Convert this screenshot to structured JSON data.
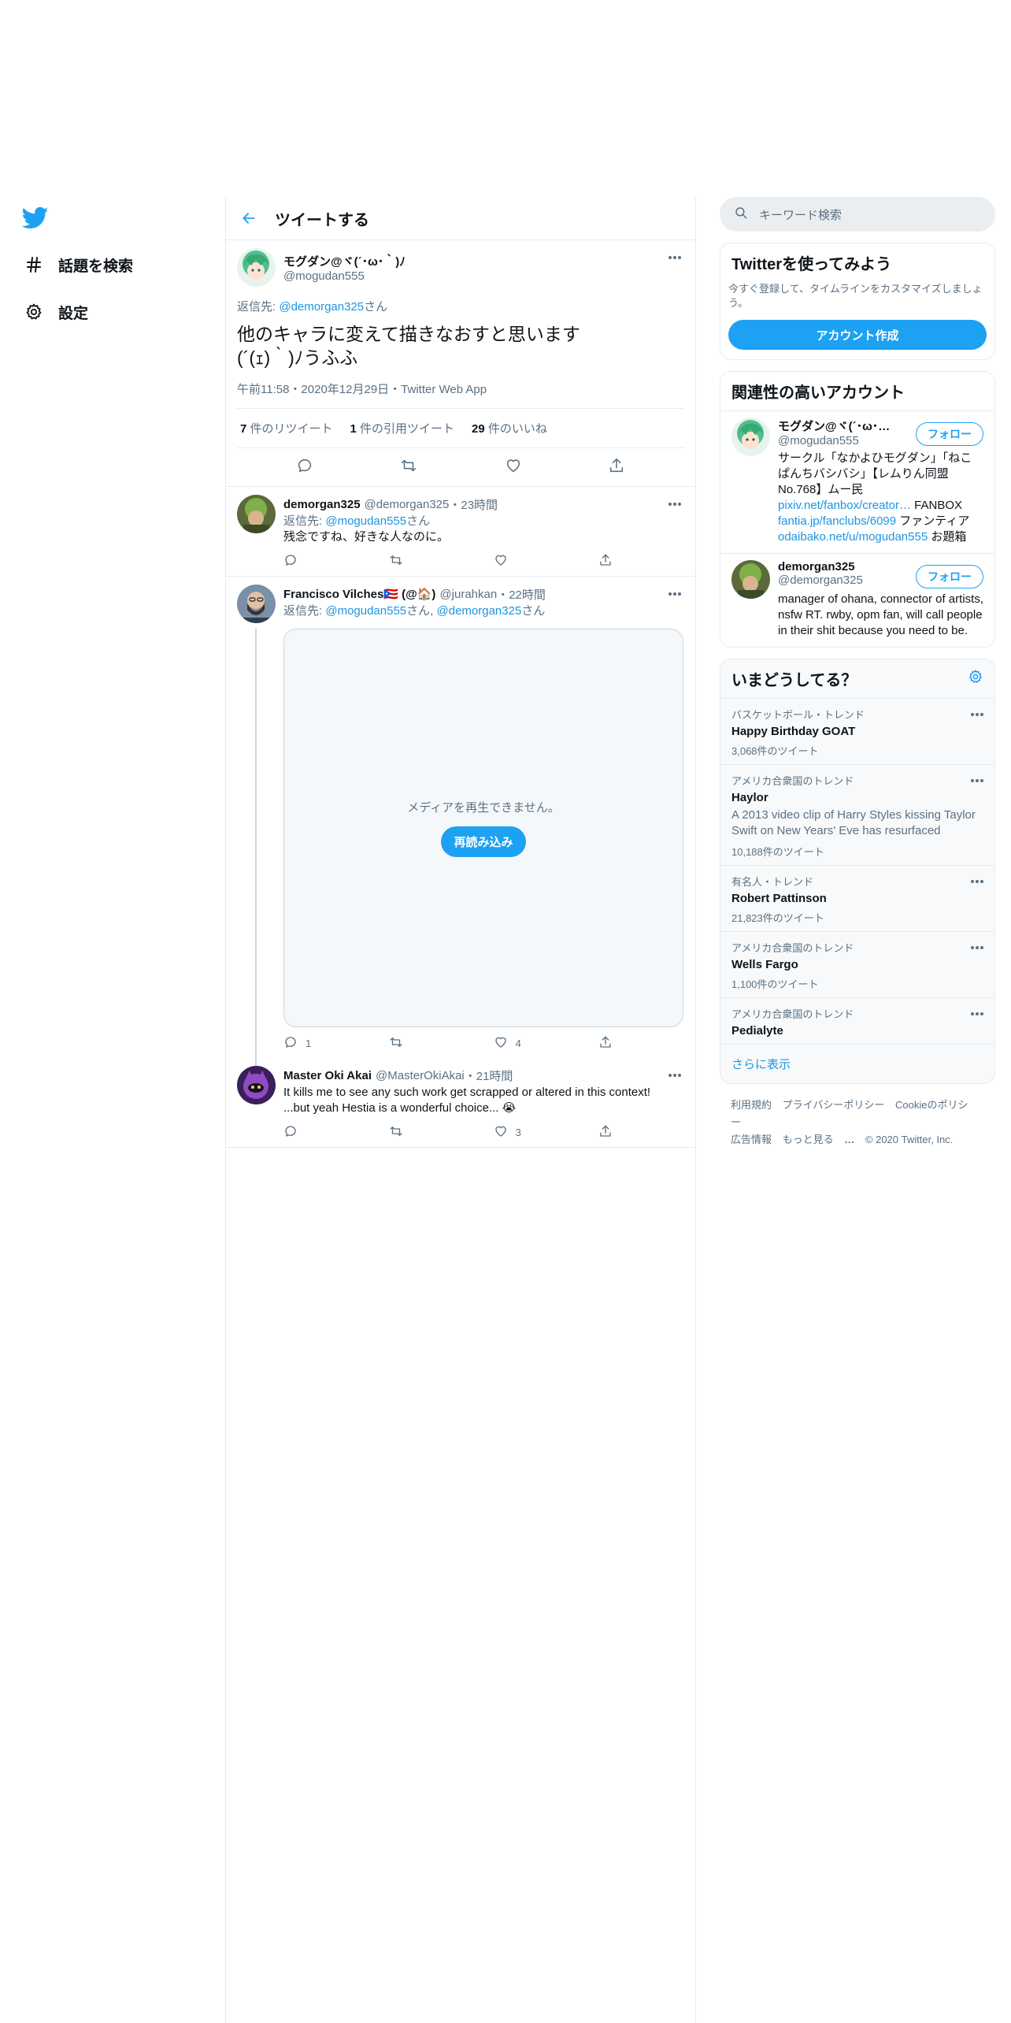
{
  "nav": {
    "logo_icon": "twitter-bird-icon",
    "items": [
      {
        "icon": "hashtag-icon",
        "label": "話題を検索"
      },
      {
        "icon": "gear-icon",
        "label": "設定"
      }
    ]
  },
  "header": {
    "title": "ツイートする"
  },
  "focal": {
    "name": "モグダン@ヾ(´･ω･｀)ﾉ",
    "handle": "@mogudan555",
    "reply_prefix": "返信先: ",
    "reply_to": "@demorgan325",
    "reply_suffix": "さん",
    "text_line1": "他のキャラに変えて描きなおすと思います",
    "text_line2": "(´(ｪ)｀)ﾉうふふ",
    "meta": "午前11:58・2020年12月29日・Twitter Web App",
    "retweets_count": "7",
    "retweets_label": " 件のリツイート",
    "quotes_count": "1",
    "quotes_label": " 件の引用ツイート",
    "likes_count": "29",
    "likes_label": " 件のいいね"
  },
  "replies": [
    {
      "name": "demorgan325",
      "handle": "@demorgan325",
      "time": "・23時間",
      "reply_prefix": "返信先: ",
      "reply_to": "@mogudan555",
      "reply_suffix": "さん",
      "text": "残念ですね、好きな人なのに。"
    },
    {
      "name": "Francisco Vilches🇵🇷 (@🏠)",
      "handle": "@jurahkan",
      "time": "・22時間",
      "reply_prefix": "返信先: ",
      "reply_to": "@mogudan555",
      "reply_mid": "さん, ",
      "reply_to2": "@demorgan325",
      "reply_suffix": "さん",
      "media_message": "メディアを再生できません。",
      "reload_label": "再読み込み",
      "reply_count": "1",
      "like_count": "4"
    },
    {
      "name": "Master Oki Akai",
      "handle": "@MasterOkiAkai",
      "time": "・21時間",
      "text_line1": "It kills me to see any such work get scrapped or altered in this context!",
      "text_line2": "...but yeah Hestia is a wonderful choice... 😭",
      "like_count": "3"
    }
  ],
  "search": {
    "placeholder": "キーワード検索"
  },
  "signup": {
    "title": "Twitterを使ってみよう",
    "desc": "今すぐ登録して、タイムラインをカスタマイズしましょう。",
    "button": "アカウント作成"
  },
  "related": {
    "title": "関連性の高いアカウント",
    "follow_label": "フォロー",
    "accounts": [
      {
        "name": "モグダン@ヾ(´･ω･｀)ﾉ",
        "handle": "@mogudan555",
        "bio_line1": "サークル「なかよひモグダン」「ねこぱんちバシバシ」【レムりん同盟No.768】ムー民",
        "link1": "pixiv.net/fanbox/creator…",
        "bio_mid1": " FANBOX ",
        "link2": "fantia.jp/fanclubs/6099",
        "bio_mid2": " ファンティア",
        "link3": "odaibako.net/u/mogudan555",
        "bio_end": " お題箱"
      },
      {
        "name": "demorgan325",
        "handle": "@demorgan325",
        "bio": "manager of ohana, connector of artists, nsfw RT. rwby, opm fan, will call people in their shit because you need to be."
      }
    ]
  },
  "trends": {
    "title": "いまどうしてる？",
    "items": [
      {
        "context": "バスケットボール・トレンド",
        "name": "Happy Birthday GOAT",
        "count": "3,068件のツイート"
      },
      {
        "context": "アメリカ合衆国のトレンド",
        "name": "Haylor",
        "desc": "A 2013 video clip of Harry Styles kissing Taylor Swift on New Years' Eve has resurfaced",
        "count": "10,188件のツイート"
      },
      {
        "context": "有名人・トレンド",
        "name": "Robert Pattinson",
        "count": "21,823件のツイート"
      },
      {
        "context": "アメリカ合衆国のトレンド",
        "name": "Wells Fargo",
        "count": "1,100件のツイート"
      },
      {
        "context": "アメリカ合衆国のトレンド",
        "name": "Pedialyte"
      }
    ],
    "show_more": "さらに表示"
  },
  "footer": {
    "terms": "利用規約",
    "privacy": "プライバシーポリシー",
    "cookie": "Cookieのポリシー",
    "ads": "広告情報",
    "more": "もっと見る",
    "copyright": "© 2020 Twitter, Inc."
  },
  "colors": {
    "accent": "#1da1f2",
    "link": "#1b95e0",
    "secondary_text": "#5b7083",
    "border": "#e6ecf0"
  }
}
